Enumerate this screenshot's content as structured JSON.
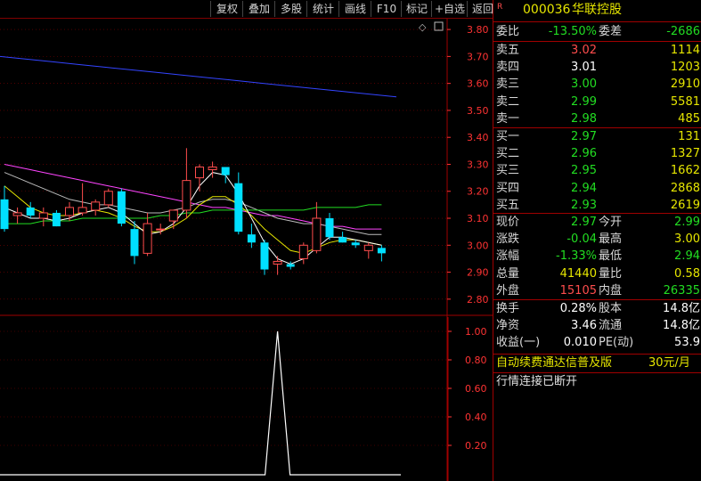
{
  "toolbar": {
    "buttons": [
      "复权",
      "叠加",
      "多股",
      "统计",
      "画线",
      "F10",
      "标记",
      "+自选",
      "返回"
    ]
  },
  "colors": {
    "up": "#ff4d4d",
    "down": "#22dd22",
    "flat": "#ffffff",
    "accent": "#e6e600",
    "candle_up": "#ff4d4d",
    "candle_down": "#00e0ff",
    "ma_blue": "#3344ff",
    "ma_magenta": "#ff44ff",
    "ma_green": "#22dd22",
    "ma_white": "#ffffff",
    "ma_yellow": "#e6e600",
    "ma_grey": "#bbbbbb",
    "axis_text": "#ff3333",
    "grid": "#800000"
  },
  "stock": {
    "badge": "R",
    "code": "000036",
    "name": "华联控股"
  },
  "weibi": {
    "label1": "委比",
    "value1": "-13.50%",
    "label2": "委差",
    "value2": "-2686"
  },
  "sell": [
    {
      "label": "卖五",
      "price": "3.02",
      "vol": "1114",
      "color": "up"
    },
    {
      "label": "卖四",
      "price": "3.01",
      "vol": "1203",
      "color": "flat"
    },
    {
      "label": "卖三",
      "price": "3.00",
      "vol": "2910",
      "color": "down"
    },
    {
      "label": "卖二",
      "price": "2.99",
      "vol": "5581",
      "color": "down"
    },
    {
      "label": "卖一",
      "price": "2.98",
      "vol": "485",
      "color": "down"
    }
  ],
  "buy": [
    {
      "label": "买一",
      "price": "2.97",
      "vol": "131",
      "color": "down"
    },
    {
      "label": "买二",
      "price": "2.96",
      "vol": "1327",
      "color": "down"
    },
    {
      "label": "买三",
      "price": "2.95",
      "vol": "1662",
      "color": "down"
    },
    {
      "label": "买四",
      "price": "2.94",
      "vol": "2868",
      "color": "down"
    },
    {
      "label": "买五",
      "price": "2.93",
      "vol": "2619",
      "color": "down"
    }
  ],
  "quote": [
    {
      "l1": "现价",
      "v1": "2.97",
      "c1": "down",
      "l2": "今开",
      "v2": "2.99",
      "c2": "down"
    },
    {
      "l1": "涨跌",
      "v1": "-0.04",
      "c1": "down",
      "l2": "最高",
      "v2": "3.00",
      "c2": "accent"
    },
    {
      "l1": "涨幅",
      "v1": "-1.33%",
      "c1": "down",
      "l2": "最低",
      "v2": "2.94",
      "c2": "down"
    },
    {
      "l1": "总量",
      "v1": "41440",
      "c1": "accent",
      "l2": "量比",
      "v2": "0.58",
      "c2": "accent"
    },
    {
      "l1": "外盘",
      "v1": "15105",
      "c1": "up",
      "l2": "内盘",
      "v2": "26335",
      "c2": "down"
    }
  ],
  "fund": [
    {
      "l1": "换手",
      "v1": "0.28%",
      "l2": "股本",
      "v2": "14.8亿"
    },
    {
      "l1": "净资",
      "v1": "3.46",
      "l2": "流通",
      "v2": "14.8亿"
    },
    {
      "l1": "收益(一)",
      "v1": "0.010",
      "l2": "PE(动)",
      "v2": "53.9"
    }
  ],
  "notice": {
    "text": "自动续费通达信普及版",
    "price": "30元/月"
  },
  "status": "行情连接已断开",
  "chart_data": [
    {
      "type": "candlestick",
      "y_ticks": [
        "3.80",
        "3.70",
        "3.60",
        "3.50",
        "3.40",
        "3.30",
        "3.20",
        "3.10",
        "3.00",
        "2.90",
        "2.80"
      ],
      "ylim": [
        2.74,
        3.84
      ],
      "candles": [
        {
          "o": 3.17,
          "h": 3.22,
          "l": 3.05,
          "c": 3.06,
          "dir": "down"
        },
        {
          "o": 3.11,
          "h": 3.14,
          "l": 3.08,
          "c": 3.12,
          "dir": "up"
        },
        {
          "o": 3.14,
          "h": 3.16,
          "l": 3.1,
          "c": 3.11,
          "dir": "down"
        },
        {
          "o": 3.1,
          "h": 3.14,
          "l": 3.07,
          "c": 3.12,
          "dir": "up"
        },
        {
          "o": 3.12,
          "h": 3.13,
          "l": 3.07,
          "c": 3.07,
          "dir": "down"
        },
        {
          "o": 3.11,
          "h": 3.16,
          "l": 3.09,
          "c": 3.14,
          "dir": "up"
        },
        {
          "o": 3.12,
          "h": 3.23,
          "l": 3.11,
          "c": 3.14,
          "dir": "up"
        },
        {
          "o": 3.13,
          "h": 3.17,
          "l": 3.11,
          "c": 3.16,
          "dir": "up"
        },
        {
          "o": 3.15,
          "h": 3.21,
          "l": 3.14,
          "c": 3.2,
          "dir": "up"
        },
        {
          "o": 3.2,
          "h": 3.21,
          "l": 3.07,
          "c": 3.08,
          "dir": "down"
        },
        {
          "o": 3.06,
          "h": 3.09,
          "l": 2.93,
          "c": 2.96,
          "dir": "down"
        },
        {
          "o": 2.97,
          "h": 3.12,
          "l": 2.96,
          "c": 3.08,
          "dir": "up"
        },
        {
          "o": 3.06,
          "h": 3.08,
          "l": 3.04,
          "c": 3.06,
          "dir": "up"
        },
        {
          "o": 3.09,
          "h": 3.12,
          "l": 3.06,
          "c": 3.13,
          "dir": "up"
        },
        {
          "o": 3.13,
          "h": 3.36,
          "l": 3.1,
          "c": 3.24,
          "dir": "up"
        },
        {
          "o": 3.25,
          "h": 3.3,
          "l": 3.2,
          "c": 3.29,
          "dir": "up"
        },
        {
          "o": 3.28,
          "h": 3.31,
          "l": 3.25,
          "c": 3.29,
          "dir": "up"
        },
        {
          "o": 3.29,
          "h": 3.29,
          "l": 3.23,
          "c": 3.26,
          "dir": "down"
        },
        {
          "o": 3.23,
          "h": 3.27,
          "l": 3.04,
          "c": 3.05,
          "dir": "down"
        },
        {
          "o": 3.04,
          "h": 3.08,
          "l": 2.99,
          "c": 3.01,
          "dir": "down"
        },
        {
          "o": 3.01,
          "h": 3.02,
          "l": 2.89,
          "c": 2.91,
          "dir": "down"
        },
        {
          "o": 2.93,
          "h": 2.96,
          "l": 2.89,
          "c": 2.94,
          "dir": "up"
        },
        {
          "o": 2.93,
          "h": 2.94,
          "l": 2.91,
          "c": 2.92,
          "dir": "down"
        },
        {
          "o": 2.95,
          "h": 3.01,
          "l": 2.93,
          "c": 3.0,
          "dir": "up"
        },
        {
          "o": 2.98,
          "h": 3.16,
          "l": 2.97,
          "c": 3.1,
          "dir": "up"
        },
        {
          "o": 3.1,
          "h": 3.12,
          "l": 3.02,
          "c": 3.03,
          "dir": "down"
        },
        {
          "o": 3.03,
          "h": 3.05,
          "l": 3.01,
          "c": 3.01,
          "dir": "down"
        },
        {
          "o": 3.01,
          "h": 3.02,
          "l": 2.99,
          "c": 3.0,
          "dir": "down"
        },
        {
          "o": 2.98,
          "h": 3.01,
          "l": 2.95,
          "c": 3.0,
          "dir": "up"
        },
        {
          "o": 2.99,
          "h": 3.0,
          "l": 2.94,
          "c": 2.97,
          "dir": "down"
        }
      ],
      "lines": [
        {
          "color": "ma_blue",
          "values": [
            3.7,
            3.69,
            3.68,
            3.67,
            3.66,
            3.65,
            3.64,
            3.63,
            3.62,
            3.61,
            3.6,
            3.59,
            3.58,
            3.57,
            3.56,
            3.55
          ]
        },
        {
          "color": "ma_magenta",
          "values": [
            3.3,
            3.29,
            3.28,
            3.27,
            3.26,
            3.25,
            3.24,
            3.23,
            3.22,
            3.21,
            3.2,
            3.19,
            3.18,
            3.17,
            3.16,
            3.15,
            3.14,
            3.14,
            3.13,
            3.12,
            3.11,
            3.11,
            3.1,
            3.09,
            3.08,
            3.07,
            3.07,
            3.06,
            3.06,
            3.06
          ]
        },
        {
          "color": "ma_grey",
          "values": [
            3.27,
            3.25,
            3.23,
            3.21,
            3.19,
            3.17,
            3.16,
            3.15,
            3.15,
            3.14,
            3.13,
            3.12,
            3.12,
            3.13,
            3.14,
            3.16,
            3.17,
            3.17,
            3.16,
            3.14,
            3.12,
            3.1,
            3.09,
            3.08,
            3.08,
            3.07,
            3.06,
            3.05,
            3.04,
            3.04
          ]
        },
        {
          "color": "ma_green",
          "values": [
            3.08,
            3.08,
            3.08,
            3.09,
            3.09,
            3.09,
            3.1,
            3.1,
            3.1,
            3.1,
            3.1,
            3.1,
            3.11,
            3.11,
            3.12,
            3.12,
            3.13,
            3.13,
            3.13,
            3.13,
            3.13,
            3.13,
            3.13,
            3.13,
            3.14,
            3.14,
            3.14,
            3.14,
            3.15,
            3.15
          ]
        },
        {
          "color": "ma_yellow",
          "values": [
            3.22,
            3.18,
            3.14,
            3.12,
            3.11,
            3.11,
            3.12,
            3.13,
            3.12,
            3.1,
            3.07,
            3.05,
            3.05,
            3.07,
            3.1,
            3.15,
            3.18,
            3.18,
            3.15,
            3.11,
            3.06,
            3.02,
            2.98,
            2.97,
            2.99,
            3.01,
            3.02,
            3.02,
            3.01,
            3.0
          ]
        },
        {
          "color": "ma_white",
          "values": [
            3.14,
            3.12,
            3.1,
            3.1,
            3.09,
            3.1,
            3.12,
            3.13,
            3.14,
            3.12,
            3.08,
            3.04,
            3.05,
            3.08,
            3.14,
            3.22,
            3.27,
            3.26,
            3.19,
            3.1,
            3.01,
            2.95,
            2.93,
            2.95,
            2.99,
            3.03,
            3.03,
            3.02,
            3.01,
            3.0
          ]
        }
      ]
    },
    {
      "type": "line",
      "y_ticks": [
        "1.00",
        "0.80",
        "0.60",
        "0.40",
        "0.20"
      ],
      "ylim": [
        -0.05,
        1.1
      ],
      "spike_index": 21,
      "spike_value": 1.0,
      "baseline": 0.0
    }
  ]
}
